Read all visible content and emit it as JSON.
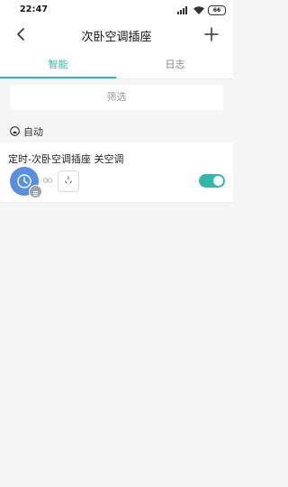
{
  "status_bar": {
    "time": "22:47",
    "battery": "66"
  },
  "nav": {
    "title": "次卧空调插座"
  },
  "tabs": [
    {
      "label": "智能",
      "active": true
    },
    {
      "label": "日志",
      "active": false
    }
  ],
  "filter": {
    "label": "筛选"
  },
  "section": {
    "label": "自动"
  },
  "rules": [
    {
      "title": "定时-次卧空调插座 关空调",
      "enabled": true
    }
  ],
  "colors": {
    "accent": "#2fb8ac",
    "clock": "#5a8fe0"
  }
}
